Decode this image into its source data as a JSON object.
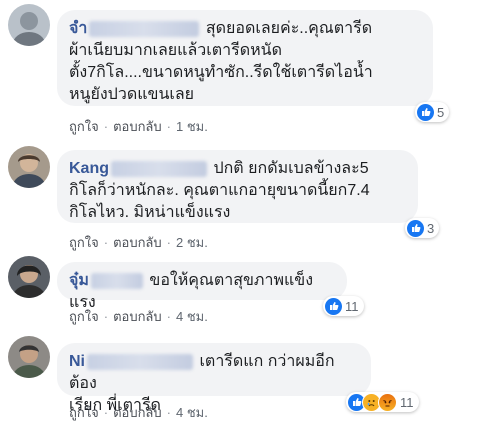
{
  "comments": [
    {
      "author_visible": "จำ",
      "text_line1_after_name": "สุดยอดเลยค่ะ..คุณตารีด",
      "text_lines": [
        "ผ้าเนียบมากเลยแล้วเตารีดหนัด",
        "ตั้ง7กิโล....ขนาดหนูทำซัก..รีดใช้เตารีดไอน้ำ",
        "หนูยังปวดแขนเลย"
      ],
      "like": "ถูกใจ",
      "reply": "ตอบกลับ",
      "time": "1 ชม.",
      "reaction_count": "5"
    },
    {
      "author_visible": "Kang",
      "text_line1_after_name": "ปกติ ยกดัมเบลข้างละ5",
      "text_lines": [
        "กิโลก็ว่าหนักละ. คุณตาแกอายุขนาดนี้ยก7.4",
        "กิโลไหว. มิหน่าแข็งแรง"
      ],
      "like": "ถูกใจ",
      "reply": "ตอบกลับ",
      "time": "2 ชม.",
      "reaction_count": "3"
    },
    {
      "author_visible": "จุ๋ม",
      "text_line1_after_name": "ขอให้คุณตาสุขภาพแข็งแรง",
      "text_lines": [],
      "like": "ถูกใจ",
      "reply": "ตอบกลับ",
      "time": "4 ชม.",
      "reaction_count": "11"
    },
    {
      "author_visible": "Ni",
      "text_line1_after_name": "เตารีดแก กว่าผมอีก ต้อง",
      "text_lines": [
        "เรียก พี่เตารีด"
      ],
      "like": "ถูกใจ",
      "reply": "ตอบกลับ",
      "time": "4 ชม.",
      "reaction_count": "11"
    }
  ],
  "separator": "·",
  "colors": {
    "link": "#385898",
    "bubble": "#f2f3f5",
    "like": "#1877f2"
  },
  "icons": [
    "like-icon",
    "sad-icon",
    "angry-icon"
  ]
}
